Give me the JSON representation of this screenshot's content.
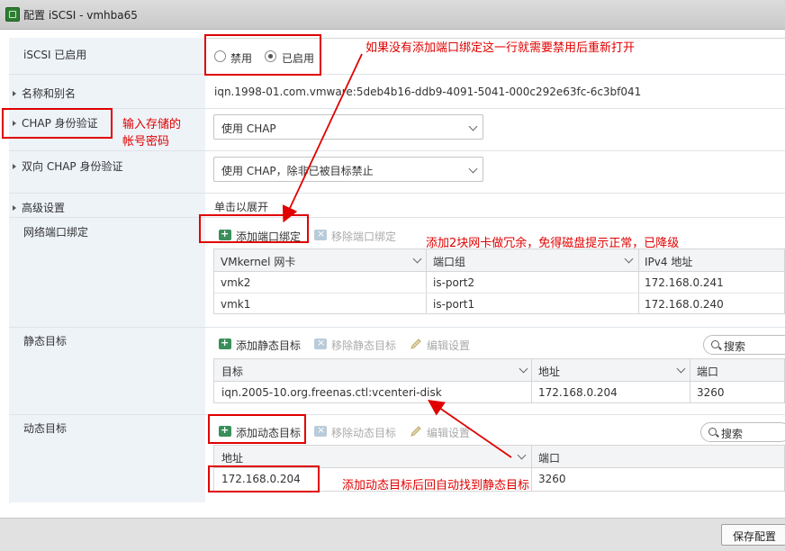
{
  "window": {
    "title": "配置 iSCSI - vmhba65"
  },
  "rows": {
    "iscsi_enabled": {
      "label": "iSCSI 已启用",
      "options": [
        {
          "label": "禁用",
          "checked": false
        },
        {
          "label": "已启用",
          "checked": true
        }
      ]
    },
    "name_alias": {
      "label": "名称和别名",
      "value": "iqn.1998-01.com.vmware:5deb4b16-ddb9-4091-5041-000c292e63fc-6c3bf041"
    },
    "chap": {
      "label": "CHAP 身份验证",
      "selected": "使用 CHAP"
    },
    "mutual_chap": {
      "label": "双向 CHAP 身份验证",
      "selected": "使用 CHAP，除非已被目标禁止"
    },
    "advanced": {
      "label": "高级设置",
      "value": "单击以展开"
    },
    "port_binding": {
      "label": "网络端口绑定",
      "add_label": "添加端口绑定",
      "remove_label": "移除端口绑定",
      "columns": [
        "VMkernel 网卡",
        "端口组",
        "IPv4 地址"
      ],
      "rows": [
        [
          "vmk2",
          "is-port2",
          "172.168.0.241"
        ],
        [
          "vmk1",
          "is-port1",
          "172.168.0.240"
        ]
      ]
    },
    "static_targets": {
      "label": "静态目标",
      "add_label": "添加静态目标",
      "remove_label": "移除静态目标",
      "edit_label": "编辑设置",
      "search_placeholder": "搜索",
      "columns": [
        "目标",
        "地址",
        "端口"
      ],
      "rows": [
        [
          "iqn.2005-10.org.freenas.ctl:vcenteri-disk",
          "172.168.0.204",
          "3260"
        ]
      ]
    },
    "dynamic_targets": {
      "label": "动态目标",
      "add_label": "添加动态目标",
      "remove_label": "移除动态目标",
      "edit_label": "编辑设置",
      "search_placeholder": "搜索",
      "columns": [
        "地址",
        "端口"
      ],
      "rows": [
        [
          "172.168.0.204",
          "3260"
        ]
      ]
    }
  },
  "footer": {
    "save_label": "保存配置"
  },
  "annotations": {
    "rebind_note": "如果没有添加端口绑定这一行就需要禁用后重新打开",
    "chap_note_line1": "输入存储的",
    "chap_note_line2": "帐号密码",
    "nic_note": "添加2块网卡做冗余，免得磁盘提示正常，已降级",
    "dynamic_note": "添加动态目标后回自动找到静态目标",
    "color": "#e00000"
  },
  "colors": {
    "label_column": "#eef3f8",
    "annotation": "#e00000",
    "add_icon": "#3a8f5a"
  }
}
